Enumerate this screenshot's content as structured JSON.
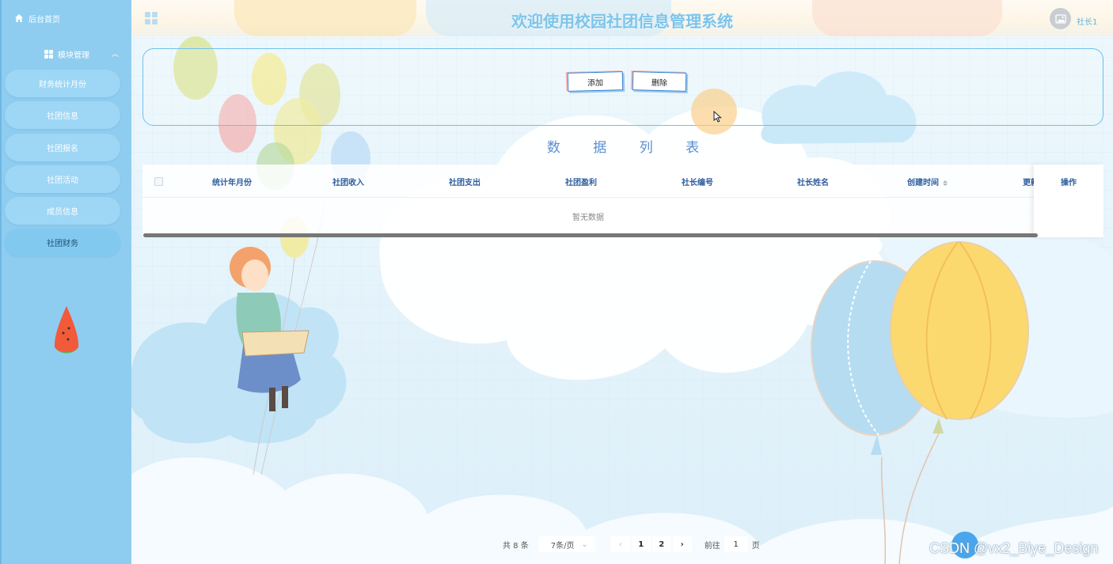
{
  "sidebar": {
    "home_label": "后台首页",
    "group_label": "模块管理",
    "items": [
      {
        "label": "财务统计月份"
      },
      {
        "label": "社团信息"
      },
      {
        "label": "社团报名"
      },
      {
        "label": "社团活动"
      },
      {
        "label": "成员信息"
      },
      {
        "label": "社团财务"
      }
    ],
    "active_index": 5
  },
  "header": {
    "title": "欢迎使用校园社团信息管理系统",
    "user_label": "社长1"
  },
  "toolbar": {
    "add_label": "添加",
    "delete_label": "删除"
  },
  "list": {
    "title": "数 据 列 表",
    "columns": [
      "统计年月份",
      "社团收入",
      "社团支出",
      "社团盈利",
      "社长编号",
      "社长姓名",
      "创建时间",
      "更新"
    ],
    "operation_label": "操作",
    "empty_text": "暂无数据"
  },
  "pagination": {
    "total_text": "共 8 条",
    "page_size": "7条/页",
    "pages": [
      "1",
      "2"
    ],
    "current_page": 1,
    "goto_label": "前往",
    "goto_value": "1",
    "page_suffix": "页"
  },
  "watermark": "CSDN @vx2_Biye_Design",
  "colors": {
    "sidebar": "#8fcdf0",
    "title": "#7ec4ea",
    "accent": "#2f7fd2",
    "header_text": "#2c5c9c"
  }
}
